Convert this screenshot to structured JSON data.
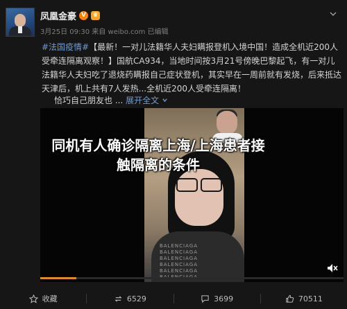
{
  "header": {
    "username": "凤凰金豪",
    "vip_badge": "V",
    "crown_badge": "♛",
    "meta": "3月25日 09:30 来自 weibo.com  已编辑",
    "menu_icon": "chevron-down-icon"
  },
  "post": {
    "hashtag": "#法国疫情#",
    "text": "【最新！一对儿法籍华人夫妇瞒报登机入境中国！造成全机近200人受牵连隔离观察！】国航CA934，当地时间按3月21号傍晚巴黎起飞，有一对儿法籍华人夫妇吃了退烧药瞒报自己症状登机，其实早在一周前就有发烧，后来抵达天津后，机上共有7人发热...全机近200人受牵连隔离！",
    "tail_text": "恰巧自己朋友也 ...",
    "expand_label": "展开全文",
    "expand_icon": "chevron-down-icon"
  },
  "video": {
    "headline_line1": "同机有人确诊隔离上海/上海患者接",
    "headline_line2": "触隔离的条件",
    "shirt_text": "BALENCIAGA BALENCIAGA BALENCIAGA BALENCIAGA BALENCIAGA BALENCIAGA",
    "progress_fraction": 0.12,
    "mute_icon": "speaker-muted-icon",
    "accent": "#e08e12"
  },
  "actions": {
    "favorite_label": "收藏",
    "repost_count": "6529",
    "comment_count": "3699",
    "like_count": "70511"
  },
  "colors": {
    "background": "#161617",
    "link": "#6f9bd1",
    "weibo_orange": "#ff8200"
  }
}
